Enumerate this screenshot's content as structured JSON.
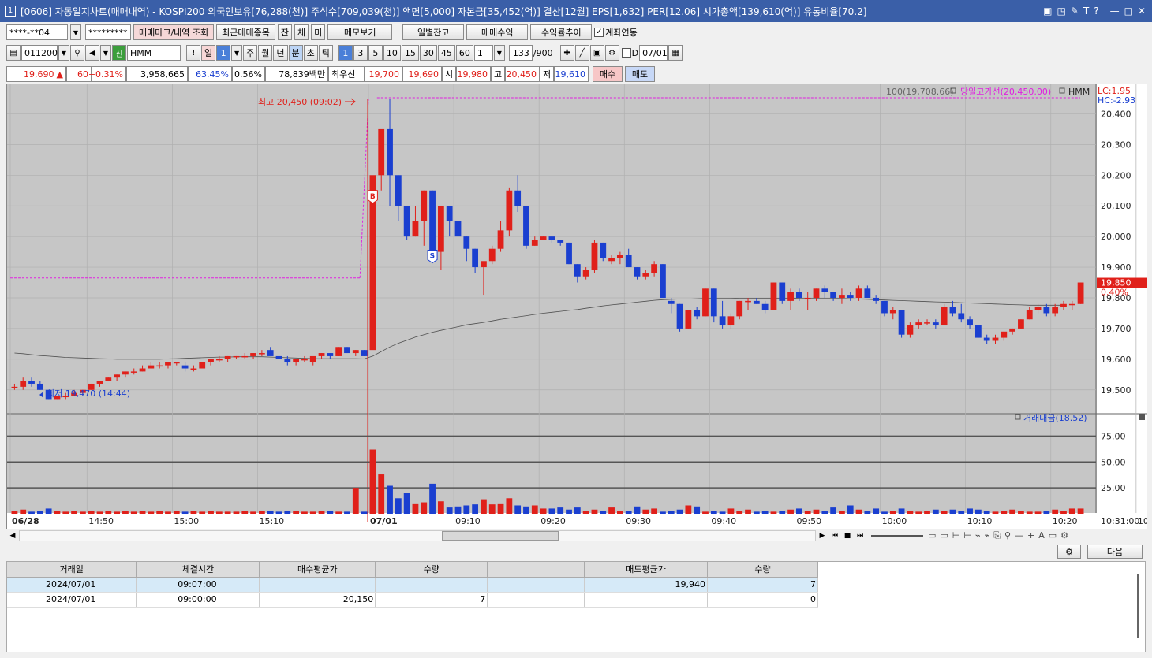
{
  "window": {
    "num": "1",
    "title": "[0606] 자동일지차트(매매내역) - KOSPI200 외국인보유[76,288(천)] 주식수[709,039(천)] 액면[5,000] 자본금[35,452(억)] 결산[12월] EPS[1,632] PER[12.06] 시가총액[139,610(억)] 유통비율[70.2]",
    "icons": [
      "restore-icon",
      "window-icon",
      "pin-icon",
      "text-icon",
      "help-icon",
      "minimize-icon",
      "maximize-icon",
      "close-icon"
    ]
  },
  "toolbar1": {
    "account": "****-**04",
    "password": "*********",
    "btn_mark": "매매마크/내역 조회",
    "btn_recent": "최근매매종목",
    "btn_jan": "잔",
    "btn_che": "체",
    "btn_mi": "미",
    "btn_memo": "메모보기",
    "btn_daily_balance": "일별잔고",
    "btn_profit": "매매수익",
    "btn_return": "수익률추이",
    "chk_link": "계좌연동"
  },
  "toolbar2": {
    "code": "011200",
    "shin": "신",
    "name": "HMM",
    "excl": "!",
    "il": "일",
    "il_num": "1",
    "periods": [
      "주",
      "월",
      "년"
    ],
    "minute": "분",
    "second": "초",
    "tick": "틱",
    "intervals": [
      "1",
      "3",
      "5",
      "10",
      "15",
      "30",
      "45",
      "60"
    ],
    "interval_input": "1",
    "count": "133",
    "count_total": "/900",
    "d_label": "D",
    "date": "07/01"
  },
  "quote": {
    "price": "19,690",
    "arrow": "▲",
    "change": "60",
    "pct": "+0.31%",
    "volume": "3,958,665",
    "vol_ratio": "63.45%",
    "turnover": "0.56%",
    "amount": "78,839백만",
    "best_label": "최우선",
    "best_ask": "19,700",
    "best_bid": "19,690",
    "open_label": "시",
    "open": "19,980",
    "high_label": "고",
    "high": "20,450",
    "low_label": "저",
    "low": "19,610",
    "buy_btn": "매수",
    "sell_btn": "매도"
  },
  "chart": {
    "ma_label": "100(19,708.66)",
    "prev_high_label": "당일고가선(20,450.00)",
    "symbol": "HMM",
    "lc": "LC:1.95",
    "hc": "HC:-2.93",
    "high_annot": "최고 20,450 (09:02)",
    "low_annot": "최저 19,470 (14:44)",
    "last_price": "19,850",
    "last_pct": "0.40%",
    "buy_marker": "B",
    "sell_marker": "S",
    "price_ticks": [
      "20,400",
      "20,300",
      "20,200",
      "20,100",
      "20,000",
      "19,900",
      "19,800",
      "19,700",
      "19,600",
      "19,500"
    ],
    "volume_label": "거래대금(18.52)",
    "volume_ticks": [
      "75.00",
      "50.00",
      "25.00"
    ],
    "time_ticks": [
      "06/28",
      "14:50",
      "15:00",
      "15:10",
      "07/01",
      "09:10",
      "09:20",
      "09:30",
      "09:40",
      "09:50",
      "10:00",
      "10:10",
      "10:20",
      "10:30",
      "10:31:00"
    ]
  },
  "chart_data": {
    "type": "candlestick",
    "ylim": [
      19430,
      20450
    ],
    "candles": [
      [
        19510,
        19520,
        19500,
        19510
      ],
      [
        19510,
        19540,
        19500,
        19530
      ],
      [
        19530,
        19540,
        19510,
        19520
      ],
      [
        19520,
        19530,
        19500,
        19500
      ],
      [
        19500,
        19500,
        19470,
        19470
      ],
      [
        19470,
        19480,
        19470,
        19480
      ],
      [
        19480,
        19490,
        19470,
        19480
      ],
      [
        19480,
        19500,
        19480,
        19490
      ],
      [
        19490,
        19500,
        19480,
        19500
      ],
      [
        19500,
        19520,
        19500,
        19520
      ],
      [
        19520,
        19530,
        19510,
        19530
      ],
      [
        19530,
        19540,
        19530,
        19540
      ],
      [
        19540,
        19550,
        19530,
        19550
      ],
      [
        19550,
        19560,
        19540,
        19560
      ],
      [
        19560,
        19570,
        19550,
        19560
      ],
      [
        19560,
        19580,
        19560,
        19570
      ],
      [
        19570,
        19590,
        19570,
        19580
      ],
      [
        19580,
        19590,
        19570,
        19580
      ],
      [
        19580,
        19590,
        19570,
        19590
      ],
      [
        19590,
        19590,
        19580,
        19590
      ],
      [
        19580,
        19590,
        19560,
        19570
      ],
      [
        19570,
        19580,
        19560,
        19570
      ],
      [
        19570,
        19590,
        19570,
        19590
      ],
      [
        19590,
        19600,
        19580,
        19600
      ],
      [
        19600,
        19610,
        19590,
        19600
      ],
      [
        19600,
        19610,
        19590,
        19610
      ],
      [
        19610,
        19610,
        19600,
        19610
      ],
      [
        19610,
        19620,
        19600,
        19610
      ],
      [
        19610,
        19620,
        19600,
        19620
      ],
      [
        19620,
        19630,
        19610,
        19620
      ],
      [
        19630,
        19640,
        19620,
        19610
      ],
      [
        19610,
        19620,
        19600,
        19600
      ],
      [
        19600,
        19610,
        19580,
        19590
      ],
      [
        19590,
        19600,
        19580,
        19600
      ],
      [
        19600,
        19610,
        19590,
        19600
      ],
      [
        19590,
        19600,
        19580,
        19610
      ],
      [
        19610,
        19620,
        19600,
        19620
      ],
      [
        19620,
        19620,
        19600,
        19610
      ],
      [
        19610,
        19640,
        19610,
        19640
      ],
      [
        19640,
        19640,
        19620,
        19620
      ],
      [
        19620,
        19630,
        19610,
        19630
      ],
      [
        19630,
        19630,
        19610,
        19610
      ],
      [
        19630,
        20150,
        19900,
        20200
      ],
      [
        20200,
        20320,
        20150,
        20350
      ],
      [
        20350,
        20450,
        20100,
        20200
      ],
      [
        20200,
        20200,
        20050,
        20100
      ],
      [
        20100,
        20100,
        19990,
        20000
      ],
      [
        20000,
        20100,
        20000,
        20050
      ],
      [
        20050,
        20150,
        19970,
        20150
      ],
      [
        20150,
        20150,
        19920,
        19950
      ],
      [
        19950,
        20100,
        19890,
        20100
      ],
      [
        20100,
        20100,
        20000,
        20050
      ],
      [
        20050,
        20050,
        19950,
        20000
      ],
      [
        20000,
        20000,
        19920,
        19960
      ],
      [
        19960,
        19960,
        19880,
        19900
      ],
      [
        19900,
        19900,
        19810,
        19920
      ],
      [
        19920,
        19970,
        19910,
        19960
      ],
      [
        19960,
        20050,
        19950,
        20020
      ],
      [
        20020,
        20160,
        20000,
        20150
      ],
      [
        20150,
        20200,
        20080,
        20100
      ],
      [
        20100,
        20100,
        19960,
        19970
      ],
      [
        19970,
        20000,
        19970,
        19990
      ],
      [
        19990,
        20000,
        19990,
        20000
      ],
      [
        20000,
        20000,
        19980,
        19990
      ],
      [
        19990,
        19990,
        19970,
        19980
      ],
      [
        19980,
        19980,
        19910,
        19910
      ],
      [
        19910,
        19910,
        19850,
        19870
      ],
      [
        19870,
        19900,
        19860,
        19890
      ],
      [
        19890,
        19990,
        19880,
        19980
      ],
      [
        19980,
        19980,
        19920,
        19930
      ],
      [
        19920,
        19940,
        19910,
        19930
      ],
      [
        19930,
        19950,
        19910,
        19940
      ],
      [
        19940,
        19960,
        19900,
        19900
      ],
      [
        19900,
        19900,
        19860,
        19870
      ],
      [
        19870,
        19890,
        19860,
        19880
      ],
      [
        19880,
        19920,
        19870,
        19910
      ],
      [
        19910,
        19910,
        19800,
        19800
      ],
      [
        19790,
        19800,
        19750,
        19780
      ],
      [
        19780,
        19780,
        19690,
        19700
      ],
      [
        19700,
        19760,
        19700,
        19760
      ],
      [
        19760,
        19770,
        19730,
        19740
      ],
      [
        19740,
        19830,
        19740,
        19830
      ],
      [
        19830,
        19830,
        19720,
        19740
      ],
      [
        19740,
        19790,
        19700,
        19710
      ],
      [
        19710,
        19750,
        19700,
        19740
      ],
      [
        19740,
        19790,
        19730,
        19790
      ],
      [
        19790,
        19800,
        19760,
        19790
      ],
      [
        19790,
        19800,
        19780,
        19780
      ],
      [
        19780,
        19790,
        19750,
        19760
      ],
      [
        19760,
        19850,
        19760,
        19850
      ],
      [
        19850,
        19850,
        19780,
        19790
      ],
      [
        19790,
        19830,
        19760,
        19820
      ],
      [
        19820,
        19830,
        19790,
        19800
      ],
      [
        19800,
        19820,
        19760,
        19800
      ],
      [
        19800,
        19830,
        19790,
        19830
      ],
      [
        19830,
        19840,
        19800,
        19820
      ],
      [
        19820,
        19820,
        19790,
        19800
      ],
      [
        19800,
        19830,
        19780,
        19810
      ],
      [
        19810,
        19820,
        19790,
        19800
      ],
      [
        19800,
        19840,
        19790,
        19830
      ],
      [
        19830,
        19840,
        19800,
        19800
      ],
      [
        19800,
        19810,
        19780,
        19790
      ],
      [
        19790,
        19790,
        19740,
        19750
      ],
      [
        19750,
        19770,
        19730,
        19760
      ],
      [
        19760,
        19760,
        19670,
        19680
      ],
      [
        19680,
        19720,
        19670,
        19710
      ],
      [
        19710,
        19730,
        19700,
        19720
      ],
      [
        19720,
        19730,
        19710,
        19720
      ],
      [
        19720,
        19730,
        19700,
        19710
      ],
      [
        19710,
        19780,
        19710,
        19770
      ],
      [
        19770,
        19790,
        19740,
        19750
      ],
      [
        19750,
        19780,
        19720,
        19730
      ],
      [
        19730,
        19740,
        19700,
        19710
      ],
      [
        19710,
        19710,
        19670,
        19670
      ],
      [
        19670,
        19680,
        19650,
        19660
      ],
      [
        19660,
        19680,
        19650,
        19670
      ],
      [
        19670,
        19690,
        19660,
        19690
      ],
      [
        19690,
        19700,
        19680,
        19700
      ],
      [
        19700,
        19730,
        19700,
        19730
      ],
      [
        19730,
        19770,
        19730,
        19760
      ],
      [
        19760,
        19780,
        19750,
        19770
      ],
      [
        19770,
        19780,
        19740,
        19750
      ],
      [
        19750,
        19780,
        19740,
        19770
      ],
      [
        19770,
        19790,
        19760,
        19780
      ],
      [
        19780,
        19790,
        19760,
        19780
      ],
      [
        19780,
        19850,
        19780,
        19850
      ]
    ],
    "ma": [
      19620,
      19618,
      19615,
      19612,
      19610,
      19608,
      19606,
      19605,
      19604,
      19603,
      19602,
      19601,
      19600,
      19600,
      19600,
      19600,
      19600,
      19600,
      19601,
      19602,
      19603,
      19604,
      19605,
      19606,
      19607,
      19607,
      19608,
      19608,
      19608,
      19608,
      19607,
      19606,
      19605,
      19604,
      19603,
      19602,
      19602,
      19602,
      19602,
      19602,
      19602,
      19601,
      19610,
      19625,
      19640,
      19652,
      19662,
      19672,
      19680,
      19688,
      19694,
      19700,
      19706,
      19712,
      19716,
      19720,
      19725,
      19730,
      19734,
      19738,
      19742,
      19746,
      19750,
      19753,
      19756,
      19759,
      19762,
      19766,
      19770,
      19774,
      19777,
      19780,
      19783,
      19786,
      19789,
      19792,
      19794,
      19795,
      19796,
      19796,
      19797,
      19798,
      19798,
      19798,
      19798,
      19799,
      19799,
      19799,
      19799,
      19799,
      19799,
      19799,
      19798,
      19798,
      19798,
      19798,
      19798,
      19798,
      19797,
      19796,
      19795,
      19794,
      19793,
      19792,
      19791,
      19790,
      19789,
      19788,
      19787,
      19786,
      19785,
      19784,
      19783,
      19782,
      19781,
      19780,
      19779,
      19778,
      19777,
      19776,
      19776,
      19776,
      19776,
      19776
    ],
    "volume": [
      3,
      4,
      2,
      3,
      5,
      3,
      2,
      3,
      2,
      3,
      2,
      3,
      2,
      3,
      2,
      3,
      2,
      3,
      2,
      3,
      2,
      3,
      2,
      3,
      2,
      2,
      2,
      3,
      2,
      3,
      3,
      2,
      3,
      3,
      2,
      2,
      3,
      3,
      2,
      2,
      25,
      2,
      62,
      38,
      27,
      15,
      20,
      10,
      11,
      29,
      12,
      6,
      7,
      8,
      9,
      14,
      9,
      10,
      15,
      8,
      7,
      8,
      5,
      5,
      6,
      4,
      6,
      3,
      4,
      3,
      6,
      3,
      3,
      7,
      4,
      5,
      2,
      3,
      4,
      8,
      7,
      2,
      3,
      2,
      5,
      3,
      4,
      2,
      3,
      2,
      3,
      4,
      5,
      3,
      4,
      3,
      6,
      3,
      8,
      4,
      3,
      5,
      2,
      3,
      5,
      3,
      2,
      3,
      4,
      3,
      4,
      3,
      5,
      4,
      3,
      2,
      3,
      4,
      3,
      2,
      2,
      3,
      4,
      3,
      5,
      5
    ]
  },
  "trades": {
    "headers": [
      "거래일",
      "체결시간",
      "매수평균가",
      "수량",
      "",
      "매도평균가",
      "수량"
    ],
    "rows": [
      [
        "2024/07/01",
        "09:07:00",
        "",
        "",
        "",
        "19,940",
        "7"
      ],
      [
        "2024/07/01",
        "09:00:00",
        "20,150",
        "7",
        "",
        "",
        "0"
      ]
    ],
    "next_btn": "다음"
  }
}
